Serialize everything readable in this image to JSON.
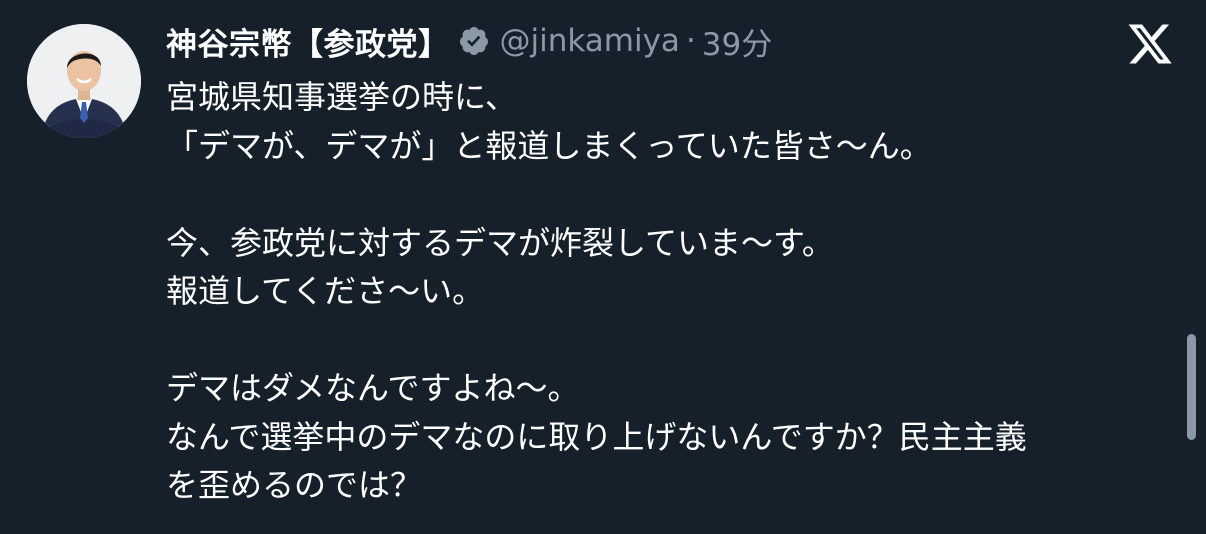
{
  "author": {
    "display_name": "神谷宗幣【参政党】",
    "handle": "@jinkamiya",
    "separator": "·",
    "timestamp": "39分"
  },
  "icons": {
    "verified": "verified-badge-icon",
    "platform": "x-logo-icon"
  },
  "colors": {
    "background": "#15202b",
    "text": "#ffffff",
    "secondary_text": "#8b98a5"
  },
  "tweet": {
    "lines": [
      "宮城県知事選挙の時に、",
      "「デマが、デマが」と報道しまくっていた皆さ〜ん。",
      "",
      "今、参政党に対するデマが炸裂していま〜す。",
      "報道してくださ〜い。",
      "",
      "デマはダメなんですよね〜。",
      "なんで選挙中のデマなのに取り上げないんですか？民主主義",
      "を歪めるのでは？"
    ]
  }
}
